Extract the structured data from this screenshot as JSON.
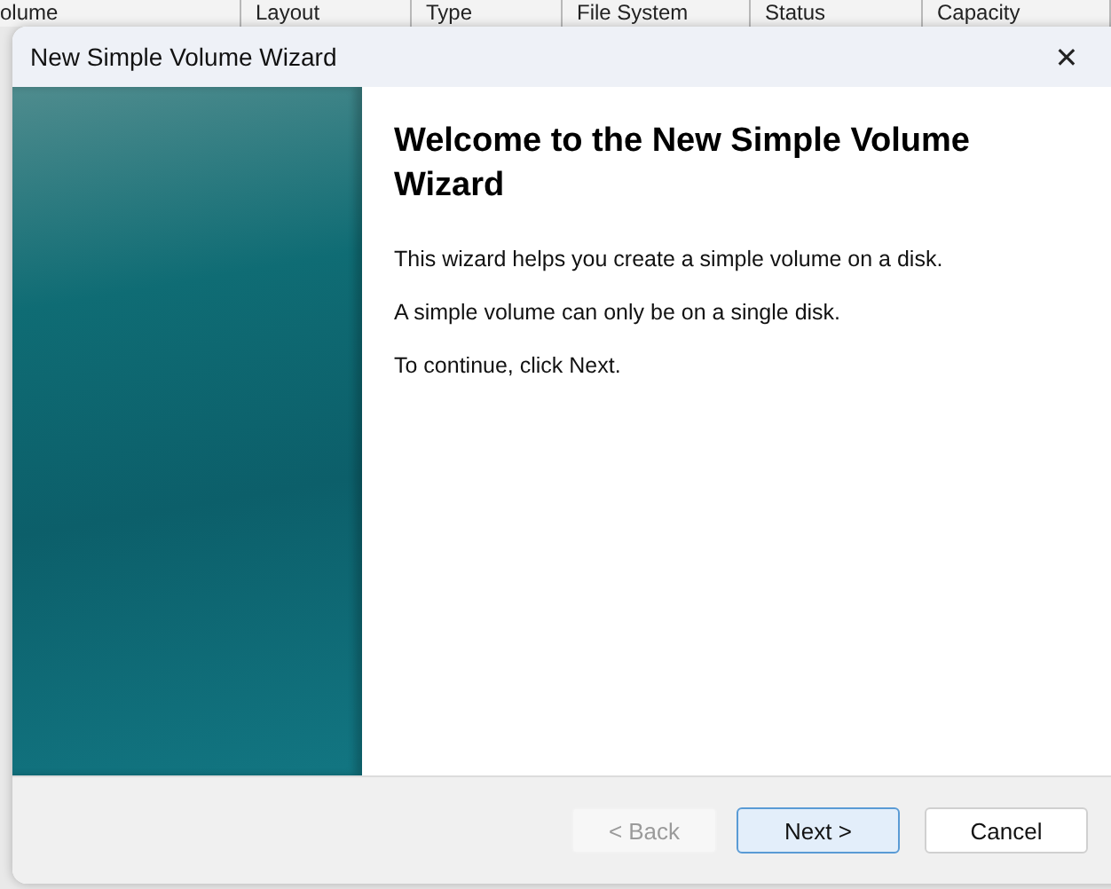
{
  "background_table": {
    "columns": [
      "olume",
      "Layout",
      "Type",
      "File System",
      "Status",
      "Capacity"
    ]
  },
  "window": {
    "title": "New Simple Volume Wizard",
    "close": "✕"
  },
  "heading": "Welcome to the New Simple Volume Wizard",
  "paragraphs": [
    "This wizard helps you create a simple volume on a disk.",
    "A simple volume can only be on a single disk.",
    "To continue, click Next."
  ],
  "buttons": [
    {
      "label": "< Back",
      "disabled": true,
      "default": false
    },
    {
      "label": "Next >",
      "disabled": false,
      "default": true
    },
    {
      "label": "Cancel",
      "disabled": false,
      "default": false
    }
  ]
}
